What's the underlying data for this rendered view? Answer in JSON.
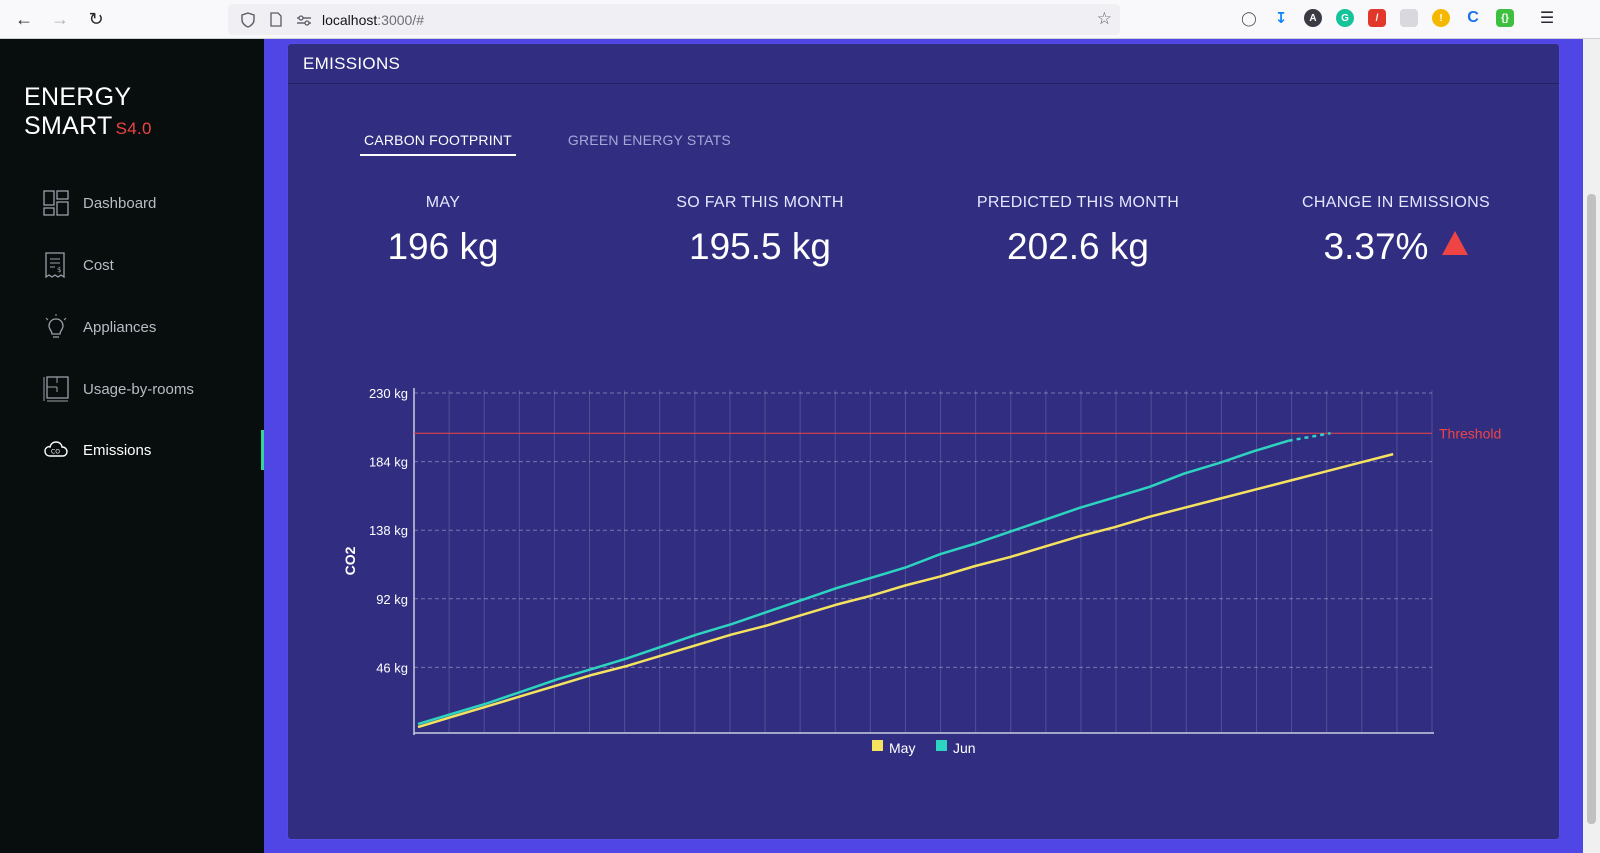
{
  "browser": {
    "url_host": "localhost",
    "url_rest": ":3000/#"
  },
  "sidebar": {
    "brand": "ENERGY SMART",
    "version": "S4.0",
    "items": [
      {
        "label": "Dashboard",
        "icon": "dashboard-icon",
        "active": false
      },
      {
        "label": "Cost",
        "icon": "receipt-icon",
        "active": false
      },
      {
        "label": "Appliances",
        "icon": "lightbulb-icon",
        "active": false
      },
      {
        "label": "Usage-by-rooms",
        "icon": "floorplan-icon",
        "active": false
      },
      {
        "label": "Emissions",
        "icon": "co2-cloud-icon",
        "active": true
      }
    ]
  },
  "panel": {
    "title": "EMISSIONS",
    "tabs": [
      {
        "label": "CARBON FOOTPRINT",
        "active": true
      },
      {
        "label": "GREEN ENERGY STATS",
        "active": false
      }
    ],
    "stats": [
      {
        "label": "MAY",
        "value": "196 kg"
      },
      {
        "label": "SO FAR THIS MONTH",
        "value": "195.5 kg"
      },
      {
        "label": "PREDICTED THIS MONTH",
        "value": "202.6 kg"
      },
      {
        "label": "CHANGE IN EMISSIONS",
        "value": "3.37%",
        "trend": "up"
      }
    ]
  },
  "colors": {
    "may": "#f5e25f",
    "jun": "#2dd4bf",
    "threshold": "#ef4444",
    "accent": "#34d399"
  },
  "chart_data": {
    "type": "line",
    "title": "",
    "xlabel": "",
    "ylabel": "CO2",
    "ylim": [
      0,
      230
    ],
    "yticks": [
      "46 kg",
      "92 kg",
      "138 kg",
      "184 kg",
      "230 kg"
    ],
    "ytick_values": [
      46,
      92,
      138,
      184,
      230
    ],
    "x": [
      1,
      2,
      3,
      4,
      5,
      6,
      7,
      8,
      9,
      10,
      11,
      12,
      13,
      14,
      15,
      16,
      17,
      18,
      19,
      20,
      21,
      22,
      23,
      24,
      25,
      26,
      27,
      28,
      29,
      30
    ],
    "grid": true,
    "legend": "bottom-center",
    "threshold": {
      "label": "Threshold",
      "value": 203
    },
    "series": [
      {
        "name": "May",
        "values": [
          6,
          13,
          20,
          27,
          34,
          41,
          47,
          54,
          61,
          68,
          74,
          81,
          88,
          94,
          101,
          107,
          114,
          120,
          127,
          134,
          140,
          147,
          153,
          159,
          165,
          171,
          177,
          183,
          189
        ]
      },
      {
        "name": "Jun",
        "values": [
          8,
          15,
          22,
          30,
          38,
          45,
          52,
          60,
          68,
          75,
          83,
          91,
          99,
          106,
          113,
          122,
          129,
          137,
          145,
          153,
          160,
          167,
          176,
          183,
          191,
          198
        ],
        "predicted": [
          198,
          203
        ]
      }
    ]
  }
}
